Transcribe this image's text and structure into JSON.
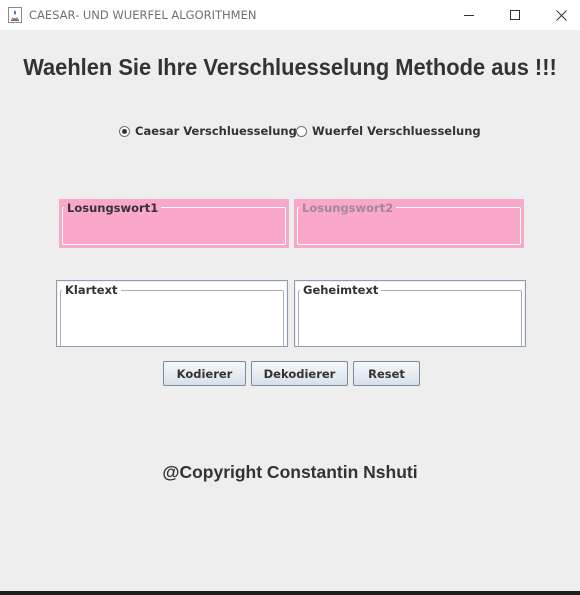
{
  "window": {
    "title": "CAESAR- UND WUERFEL ALGORITHMEN",
    "icon": "java-app-icon",
    "controls": [
      "minimize-icon",
      "maximize-icon",
      "close-icon"
    ]
  },
  "heading": "Waehlen Sie Ihre Verschluesselung Methode aus !!!",
  "methods": [
    {
      "label": "Caesar Verschluesselung",
      "selected": true
    },
    {
      "label": "Wuerfel Verschluesselung",
      "selected": false
    }
  ],
  "keys": [
    {
      "label": "Losungswort1",
      "value": "",
      "enabled": true
    },
    {
      "label": "Losungswort2",
      "value": "",
      "enabled": false
    }
  ],
  "texts": {
    "plain": {
      "label": "Klartext",
      "value": ""
    },
    "cipher": {
      "label": "Geheimtext",
      "value": ""
    }
  },
  "buttons": {
    "encode": "Kodierer",
    "decode": "Dekodierer",
    "reset": "Reset"
  },
  "copyright": "@Copyright Constantin Nshuti",
  "colors": {
    "key_box_bg": "#f9a8c9",
    "label_enabled": "#333333",
    "label_disabled": "#a08a96"
  }
}
